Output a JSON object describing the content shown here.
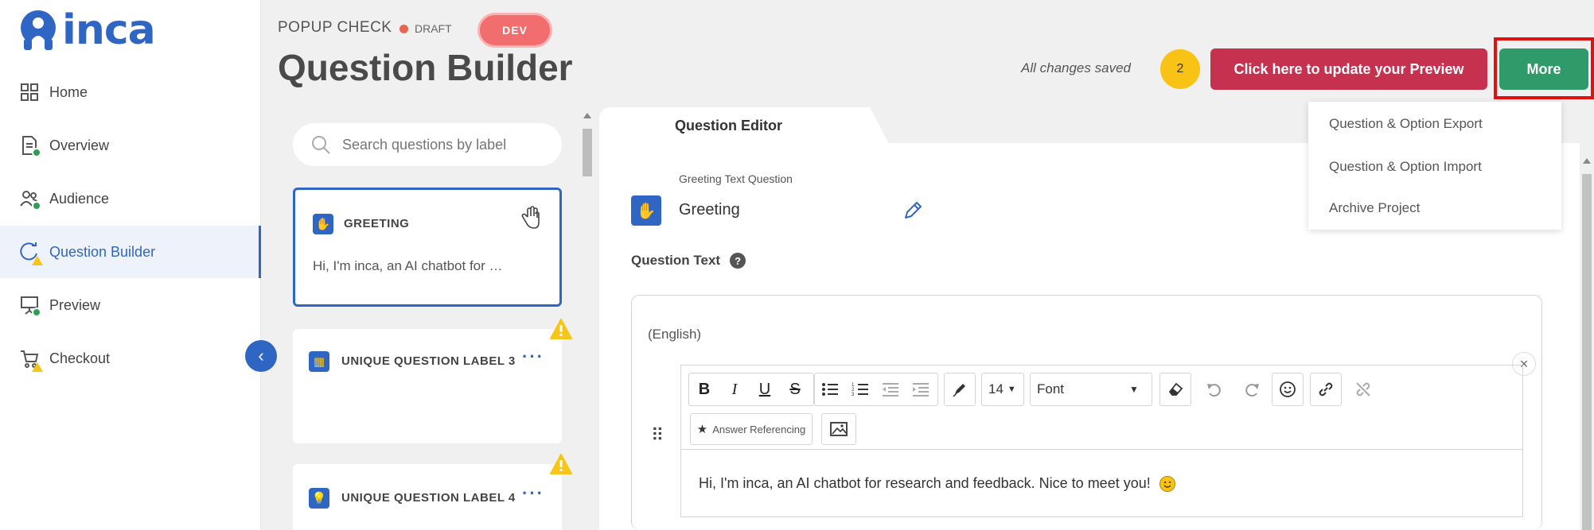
{
  "brand": {
    "name": "inca",
    "color": "#2f66c4"
  },
  "sidebar": {
    "items": [
      {
        "label": "Home",
        "icon": "grid-icon",
        "status": "none"
      },
      {
        "label": "Overview",
        "icon": "document-icon",
        "status": "complete"
      },
      {
        "label": "Audience",
        "icon": "people-icon",
        "status": "complete"
      },
      {
        "label": "Question Builder",
        "icon": "chat-cycle-icon",
        "status": "warning",
        "active": true
      },
      {
        "label": "Preview",
        "icon": "presentation-icon",
        "status": "complete"
      },
      {
        "label": "Checkout",
        "icon": "cart-icon",
        "status": "warning"
      }
    ],
    "collapse_icon": "chevron-left-icon"
  },
  "header": {
    "project_name": "POPUP CHECK",
    "state": "DRAFT",
    "env_badge": "DEV",
    "title": "Question Builder",
    "save_status": "All changes saved",
    "pending_count": "2",
    "update_button": "Click here to update your Preview",
    "more_button": "More"
  },
  "more_menu": {
    "items": [
      "Question & Option Export",
      "Question & Option Import",
      "Archive Project"
    ]
  },
  "question_list": {
    "search_placeholder": "Search questions by label",
    "cards": [
      {
        "label": "GREETING",
        "snippet": "Hi, I'm inca, an AI chatbot for …",
        "icon": "wave-hand-icon",
        "selected": true,
        "warning": false
      },
      {
        "label": "UNIQUE QUESTION LABEL 3",
        "snippet": "",
        "icon": "grid-table-icon",
        "selected": false,
        "warning": true
      },
      {
        "label": "UNIQUE QUESTION LABEL 4",
        "snippet": "",
        "icon": "lightbulb-icon",
        "selected": false,
        "warning": true
      }
    ]
  },
  "editor": {
    "tab": "Question Editor",
    "question_type": "Greeting Text Question",
    "question_name": "Greeting",
    "question_text_label": "Question Text",
    "language": "(English)",
    "font_size": "14",
    "font_name": "Font",
    "answer_referencing": "Answer Referencing",
    "content": "Hi, I'm inca, an AI chatbot for research and feedback. Nice to meet you!"
  },
  "colors": {
    "accent": "#2f66c4",
    "update_button": "#c5314f",
    "more_button": "#2f9a6a",
    "highlight": "#e01111",
    "warning": "#f5c518"
  }
}
